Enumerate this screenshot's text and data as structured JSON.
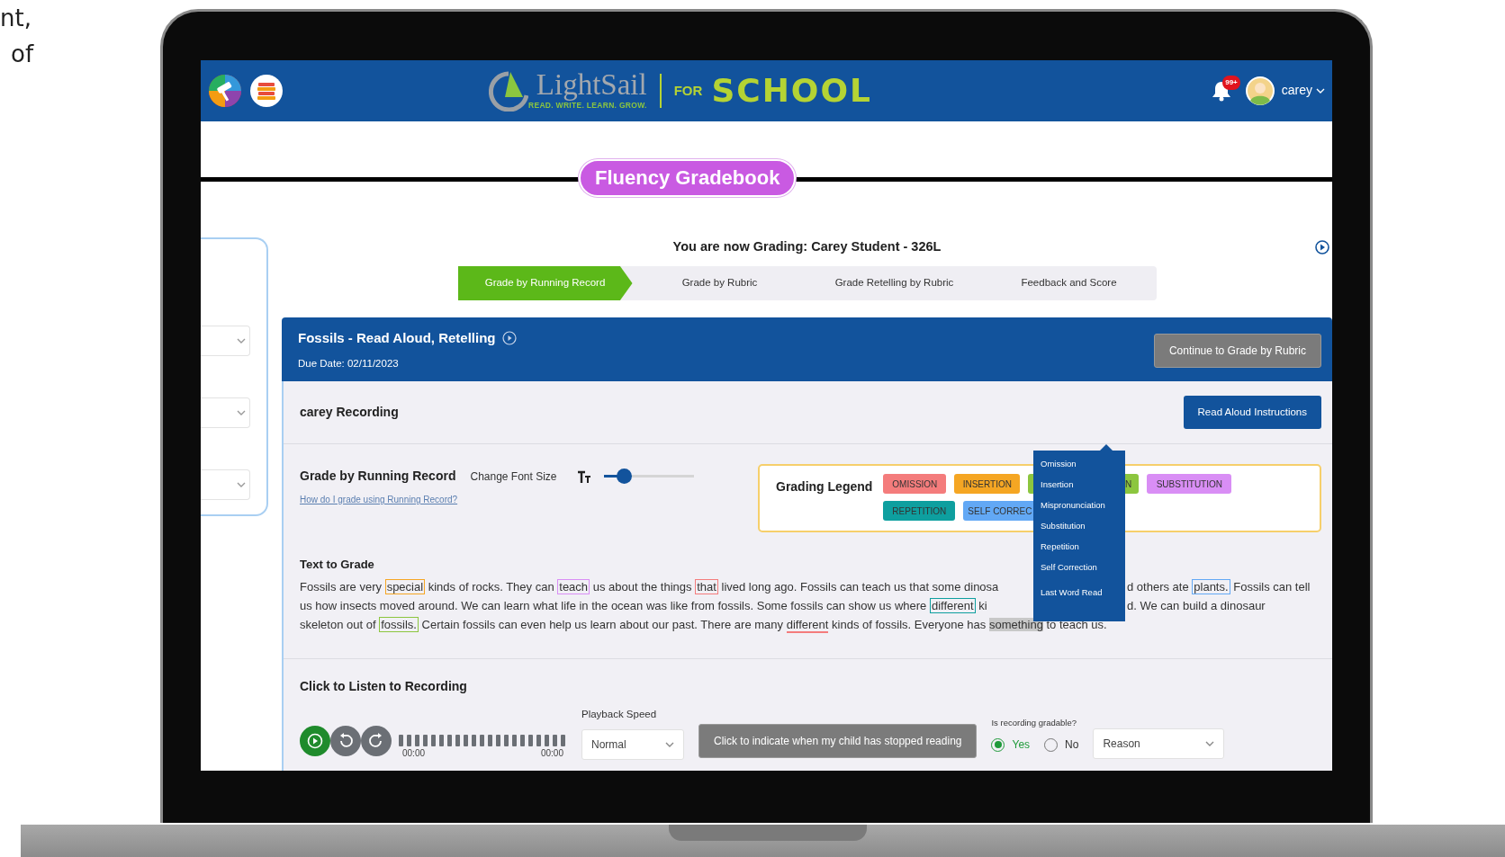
{
  "caption_fragments": [
    "nt,",
    "of"
  ],
  "header": {
    "logo": {
      "name": "LightSail",
      "tagline": "READ. WRITE. LEARN. GROW.",
      "for": "FOR",
      "school": "SCHOOL"
    },
    "notification_count": "99+",
    "user": "carey"
  },
  "page_title": "Fluency Gradebook",
  "grading_heading": "You are now Grading: Carey Student - 326L",
  "steps": [
    {
      "label": "Grade by Running Record",
      "selected": true
    },
    {
      "label": "Grade by Rubric",
      "selected": false
    },
    {
      "label": "Grade Retelling by Rubric",
      "selected": false
    },
    {
      "label": "Feedback and Score",
      "selected": false
    }
  ],
  "assignment": {
    "title": "Fossils - Read Aloud, Retelling",
    "due_date": "Due Date: 02/11/2023",
    "continue_button": "Continue to Grade by Rubric"
  },
  "recording": {
    "label": "carey Recording",
    "instructions_button": "Read Aloud Instructions"
  },
  "running_record": {
    "title": "Grade by Running Record",
    "font_size_label": "Change Font Size",
    "font_size": {
      "level": 0.26
    },
    "help_link": "How do I grade using Running Record?"
  },
  "legend": {
    "title": "Grading Legend",
    "tags": [
      {
        "label": "OMISSION",
        "color": "#f47c7c"
      },
      {
        "label": "INSERTION",
        "color": "#f5a623"
      },
      {
        "label": "N",
        "color": "#8cc63f"
      },
      {
        "label": "SUBSTITUTION",
        "color": "#d98ef5"
      },
      {
        "label": "REPETITION",
        "color": "#0e9f9f"
      },
      {
        "label": "SELF CORREC",
        "color": "#62a8f5"
      }
    ]
  },
  "error_menu": {
    "items": [
      "Omission",
      "Insertion",
      "Mispronunciation",
      "Substitution",
      "Repetition",
      "Self Correction",
      "Last Word Read"
    ]
  },
  "text_to_grade": {
    "title": "Text to Grade",
    "lines": [
      {
        "left": [
          {
            "text": "Fossils are very "
          },
          {
            "text": "special",
            "kind": "insertion"
          },
          {
            "text": " kinds of rocks. They can "
          },
          {
            "text": "teach",
            "kind": "substitution"
          },
          {
            "text": " us about the things "
          },
          {
            "text": "that",
            "kind": "omission"
          },
          {
            "text": " lived long ago. Fossils can teach us that some dinosa"
          }
        ],
        "right": [
          {
            "text": "d others ate "
          },
          {
            "text": "plants.",
            "kind": "self_correction"
          },
          {
            "text": " Fossils can tell"
          }
        ]
      },
      {
        "left": [
          {
            "text": "us how insects moved around. We can learn what life in the ocean was like from fossils. Some fossils can show us where "
          },
          {
            "text": "different",
            "kind": "repetition"
          },
          {
            "text": " ki"
          }
        ],
        "right": [
          {
            "text": "d. We can build a dinosaur"
          }
        ]
      },
      {
        "left": [
          {
            "text": "skeleton out of "
          },
          {
            "text": "fossils.",
            "kind": "mispronunciation"
          },
          {
            "text": " Certain fossils can even help us learn about our past. There are many "
          },
          {
            "text": "different",
            "kind": "underline"
          },
          {
            "text": " kinds of fossils. Everyone has "
          },
          {
            "text": "something",
            "kind": "last_word"
          },
          {
            "text": " to teach us."
          }
        ]
      }
    ]
  },
  "player": {
    "section_title": "Click to Listen to Recording",
    "elapsed": "00:00",
    "duration": "00:00",
    "playback_label": "Playback Speed",
    "playback_value": "Normal",
    "stop_button": "Click to indicate when my child has stopped reading",
    "gradable_label": "Is recording gradable?",
    "options": [
      {
        "label": "Yes",
        "selected": true
      },
      {
        "label": "No",
        "selected": false
      }
    ],
    "reason_placeholder": "Reason"
  }
}
